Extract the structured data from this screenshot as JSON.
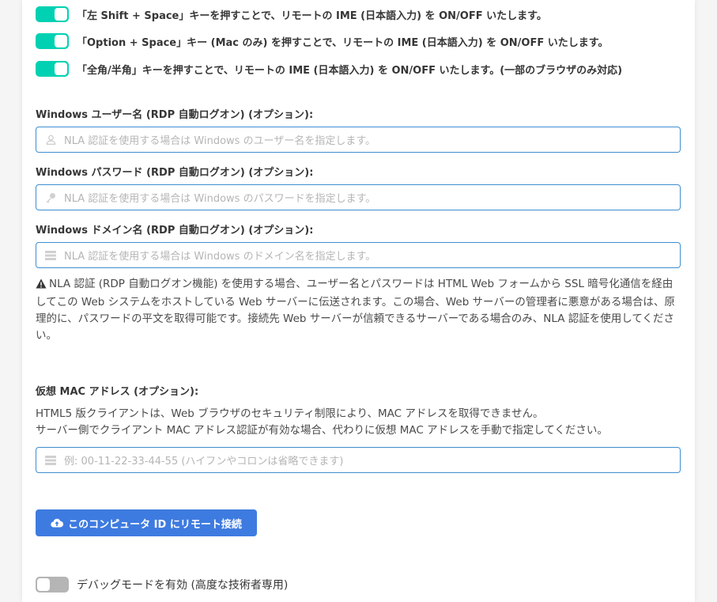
{
  "toggles": [
    {
      "label": "「左 Shift + Space」キーを押すことで、リモートの IME (日本語入力) を ON/OFF いたします。",
      "on": true
    },
    {
      "label": "「Option + Space」キー (Mac のみ) を押すことで、リモートの IME (日本語入力) を ON/OFF いたします。",
      "on": true
    },
    {
      "label": "「全角/半角」キーを押すことで、リモートの IME (日本語入力) を ON/OFF いたします。(一部のブラウザのみ対応)",
      "on": true
    }
  ],
  "username": {
    "label": "Windows ユーザー名 (RDP 自動ログオン) (オプション):",
    "placeholder": "NLA 認証を使用する場合は Windows のユーザー名を指定します。",
    "icon": "user-icon"
  },
  "password": {
    "label": "Windows パスワード (RDP 自動ログオン) (オプション):",
    "placeholder": "NLA 認証を使用する場合は Windows のパスワードを指定します。",
    "icon": "key-icon"
  },
  "domain": {
    "label": "Windows ドメイン名 (RDP 自動ログオン) (オプション):",
    "placeholder": "NLA 認証を使用する場合は Windows のドメイン名を指定します。",
    "icon": "server-icon"
  },
  "warning": {
    "icon": "warning-icon",
    "text": "NLA 認証 (RDP 自動ログオン機能) を使用する場合、ユーザー名とパスワードは HTML Web フォームから SSL 暗号化通信を経由してこの Web システムをホストしている Web サーバーに伝送されます。この場合、Web サーバーの管理者に悪意がある場合は、原理的に、パスワードの平文を取得可能です。接続先 Web サーバーが信頼できるサーバーである場合のみ、NLA 認証を使用してください。"
  },
  "mac": {
    "label": "仮想 MAC アドレス (オプション):",
    "desc_line1": "HTML5 版クライアントは、Web ブラウザのセキュリティ制限により、MAC アドレスを取得できません。",
    "desc_line2": "サーバー側でクライアント MAC アドレス認証が有効な場合、代わりに仮想 MAC アドレスを手動で指定してください。",
    "placeholder": "例: 00-11-22-33-44-55 (ハイフンやコロンは省略できます)",
    "icon": "server-icon"
  },
  "connect_button": {
    "label": "このコンピュータ ID にリモート接続",
    "icon": "cloud-upload-icon",
    "color": "#3e7be0"
  },
  "debug": {
    "label": "デバッグモードを有効 (高度な技術者専用)",
    "on": false
  },
  "colors": {
    "toggle_on": "#00d1b2",
    "toggle_off": "#b5b5b5",
    "input_border": "#3e8ed0"
  }
}
